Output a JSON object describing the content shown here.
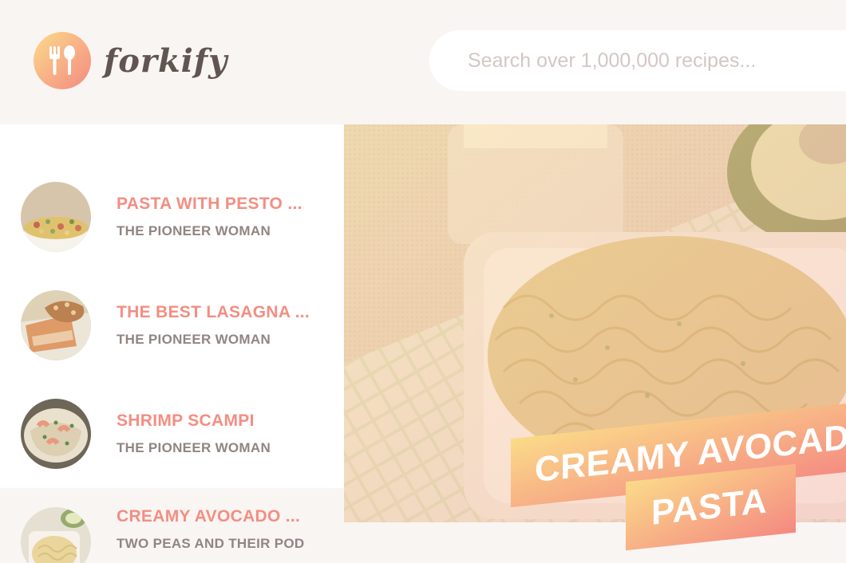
{
  "header": {
    "logo_text": "forkify",
    "search_placeholder": "Search over 1,000,000 recipes..."
  },
  "results": [
    {
      "title": "PASTA WITH PESTO ...",
      "publisher": "THE PIONEER WOMAN",
      "active": false
    },
    {
      "title": "THE BEST LASAGNA ...",
      "publisher": "THE PIONEER WOMAN",
      "active": false
    },
    {
      "title": "SHRIMP SCAMPI",
      "publisher": "THE PIONEER WOMAN",
      "active": false
    },
    {
      "title": "CREAMY AVOCADO ...",
      "publisher": "TWO PEAS AND THEIR POD",
      "active": true
    }
  ],
  "recipe": {
    "title_line1": "CREAMY AVOCADO",
    "title_line2": "PASTA"
  },
  "colors": {
    "background": "#f9f5f3",
    "accent": "#f38e82",
    "gradient_start": "#fbdb89",
    "gradient_end": "#f48982",
    "text_dark": "#615551",
    "text_muted": "#918581"
  }
}
